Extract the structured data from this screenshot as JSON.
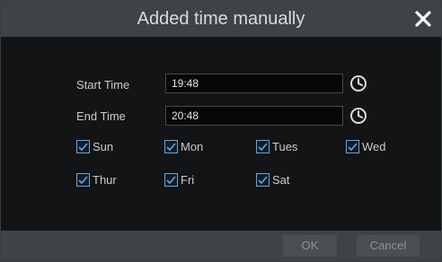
{
  "dialog": {
    "title": "Added time manually",
    "close_icon": "close-icon"
  },
  "form": {
    "start_label": "Start Time",
    "start_value": "19:48",
    "end_label": "End Time",
    "end_value": "20:48",
    "clock_icon": "clock-icon"
  },
  "days": [
    {
      "label": "Sun",
      "checked": true
    },
    {
      "label": "Mon",
      "checked": true
    },
    {
      "label": "Tues",
      "checked": true
    },
    {
      "label": "Wed",
      "checked": true
    },
    {
      "label": "Thur",
      "checked": true
    },
    {
      "label": "Fri",
      "checked": true
    },
    {
      "label": "Sat",
      "checked": true
    }
  ],
  "buttons": {
    "ok": "OK",
    "cancel": "Cancel"
  },
  "colors": {
    "accent": "#6aa6d6",
    "background": "#121416",
    "titlebar": "#3f4346"
  }
}
